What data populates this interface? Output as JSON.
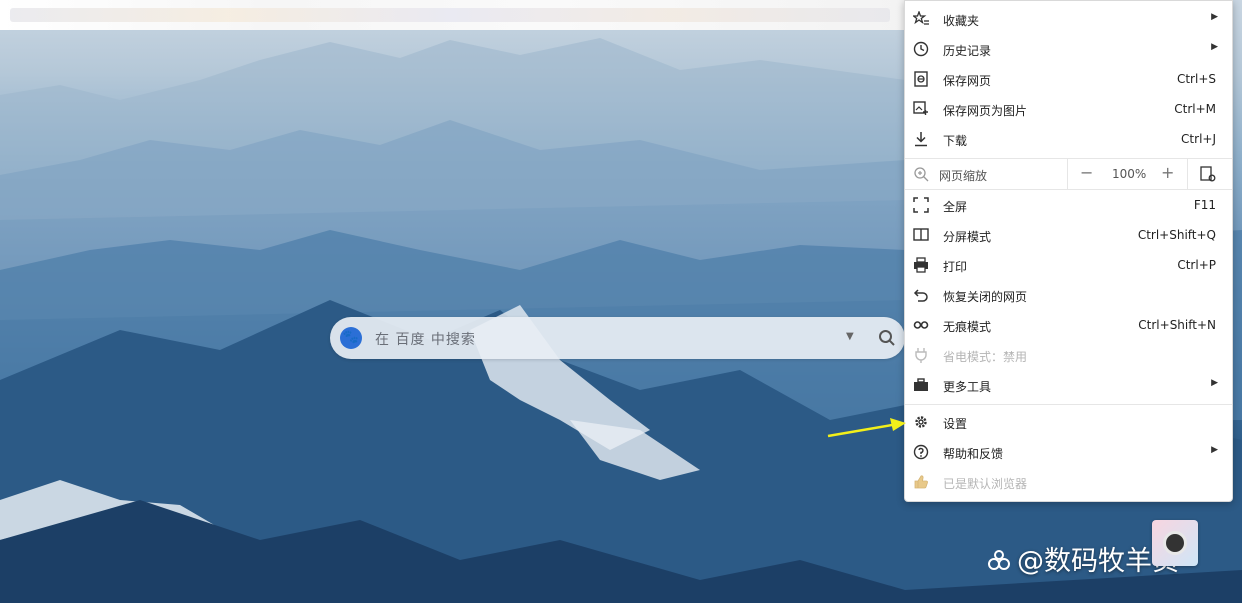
{
  "search": {
    "placeholder": "在 百度 中搜索"
  },
  "menu": {
    "items_top": [
      {
        "id": "favorites",
        "icon": "favorites-star-icon",
        "label": "收藏夹",
        "shortcut": "",
        "has_submenu": true,
        "disabled": false
      },
      {
        "id": "history",
        "icon": "clock-icon",
        "label": "历史记录",
        "shortcut": "",
        "has_submenu": true,
        "disabled": false
      },
      {
        "id": "save-page",
        "icon": "save-page-icon",
        "label": "保存网页",
        "shortcut": "Ctrl+S",
        "has_submenu": false,
        "disabled": false
      },
      {
        "id": "save-as-image",
        "icon": "image-save-icon",
        "label": "保存网页为图片",
        "shortcut": "Ctrl+M",
        "has_submenu": false,
        "disabled": false
      },
      {
        "id": "download",
        "icon": "download-icon",
        "label": "下载",
        "shortcut": "Ctrl+J",
        "has_submenu": false,
        "disabled": false
      }
    ],
    "zoom": {
      "label": "网页缩放",
      "minus": "−",
      "value": "100%",
      "plus": "+"
    },
    "items_mid": [
      {
        "id": "fullscreen",
        "icon": "fullscreen-icon",
        "label": "全屏",
        "shortcut": "F11",
        "has_submenu": false,
        "disabled": false
      },
      {
        "id": "split-screen",
        "icon": "split-screen-icon",
        "label": "分屏模式",
        "shortcut": "Ctrl+Shift+Q",
        "has_submenu": false,
        "disabled": false
      },
      {
        "id": "print",
        "icon": "printer-icon",
        "label": "打印",
        "shortcut": "Ctrl+P",
        "has_submenu": false,
        "disabled": false
      },
      {
        "id": "restore-closed",
        "icon": "undo-icon",
        "label": "恢复关闭的网页",
        "shortcut": "",
        "has_submenu": false,
        "disabled": false
      },
      {
        "id": "incognito",
        "icon": "incognito-glasses-icon",
        "label": "无痕模式",
        "shortcut": "Ctrl+Shift+N",
        "has_submenu": false,
        "disabled": false
      },
      {
        "id": "power-saving",
        "icon": "plug-icon",
        "label": "省电模式：禁用",
        "shortcut": "",
        "has_submenu": false,
        "disabled": true
      },
      {
        "id": "more-tools",
        "icon": "toolbox-icon",
        "label": "更多工具",
        "shortcut": "",
        "has_submenu": true,
        "disabled": false
      }
    ],
    "items_bottom": [
      {
        "id": "settings",
        "icon": "gear-icon",
        "label": "设置",
        "shortcut": "",
        "has_submenu": false,
        "disabled": false
      },
      {
        "id": "help",
        "icon": "help-circle-icon",
        "label": "帮助和反馈",
        "shortcut": "",
        "has_submenu": true,
        "disabled": false
      },
      {
        "id": "default-browser",
        "icon": "thumbs-up-icon",
        "label": "已是默认浏览器",
        "shortcut": "",
        "has_submenu": false,
        "disabled": true
      }
    ]
  },
  "watermark": {
    "text": "@数码牧羊员"
  },
  "colors": {
    "arrow": "#f2ef1a",
    "menu_bg": "#ffffff",
    "baidu_blue": "#2b6fd6"
  }
}
